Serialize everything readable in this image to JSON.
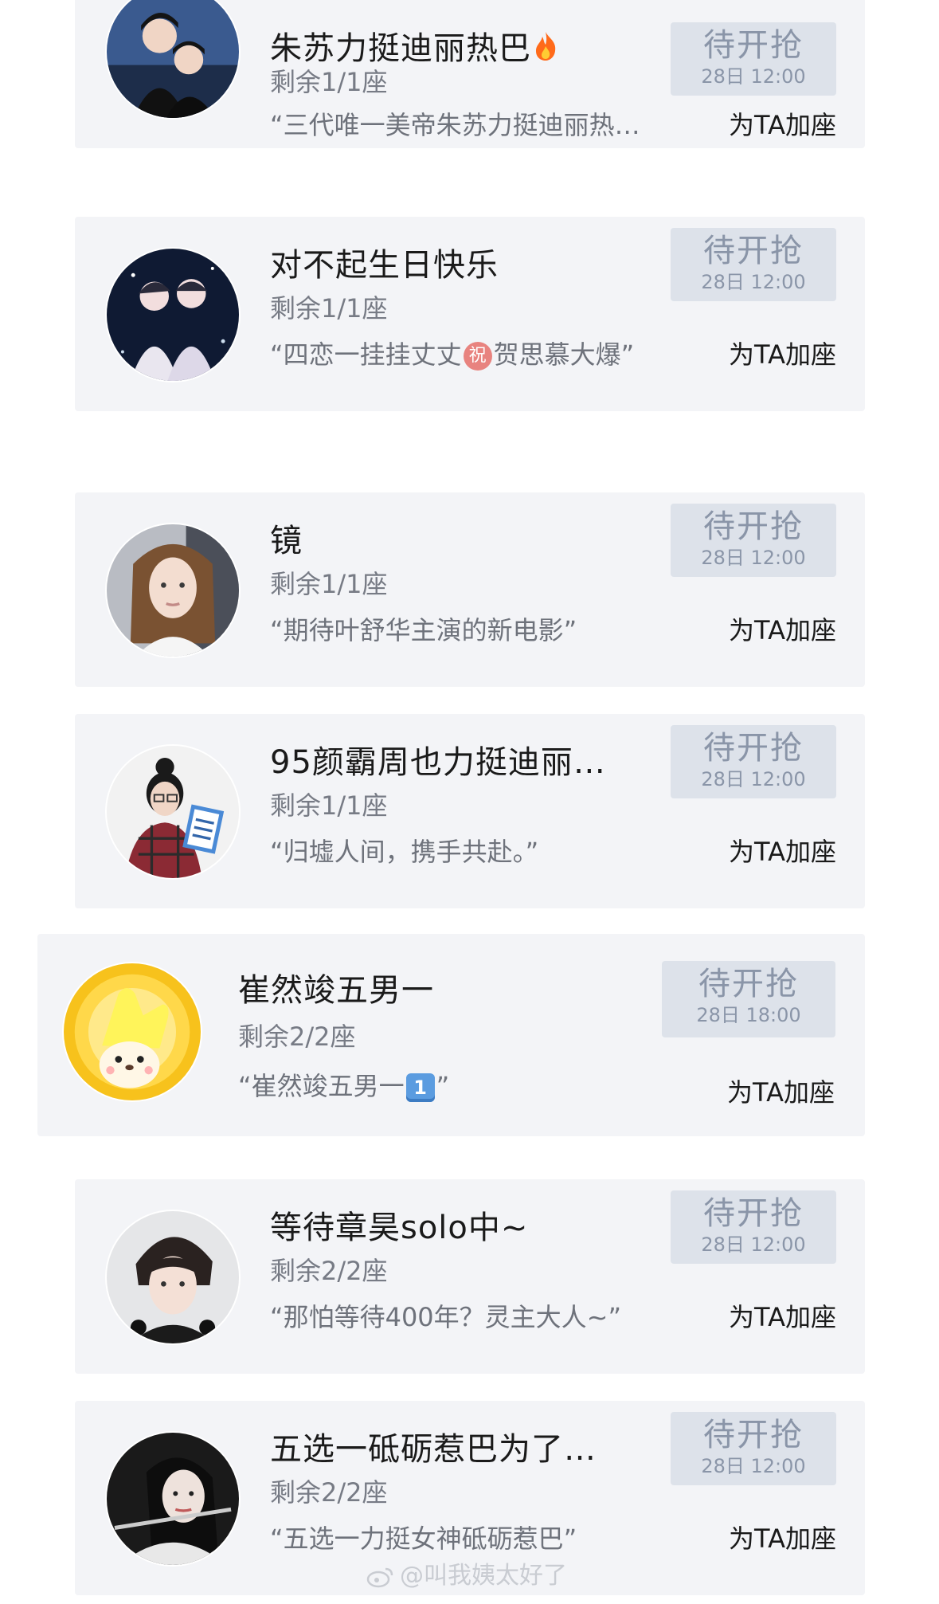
{
  "cards": [
    {
      "title": "朱苏力挺迪丽热巴",
      "seats": "剩余1/1座",
      "quote": "“三代唯一美帝朱苏力挺迪丽热…",
      "button_main": "待开抢",
      "button_time": "28日 12:00",
      "add_seat": "为TA加座",
      "title_icon": "fire-icon"
    },
    {
      "title": "对不起生日快乐",
      "seats": "剩余1/1座",
      "quote_before": "“四恋一挂挂丈丈",
      "quote_emoji": "祝",
      "quote_after": "贺思慕大爆”",
      "button_main": "待开抢",
      "button_time": "28日 12:00",
      "add_seat": "为TA加座"
    },
    {
      "title": "镜",
      "seats": "剩余1/1座",
      "quote": "“期待叶舒华主演的新电影”",
      "button_main": "待开抢",
      "button_time": "28日 12:00",
      "add_seat": "为TA加座"
    },
    {
      "title": "95颜霸周也力挺迪丽…",
      "seats": "剩余1/1座",
      "quote": "“归墟人间，携手共赴。”",
      "button_main": "待开抢",
      "button_time": "28日 12:00",
      "add_seat": "为TA加座"
    },
    {
      "title": "崔然竣五男一",
      "seats": "剩余2/2座",
      "quote_before": "“崔然竣五男一",
      "quote_emoji": "1",
      "quote_after": "”",
      "button_main": "待开抢",
      "button_time": "28日 18:00",
      "add_seat": "为TA加座"
    },
    {
      "title": "等待章昊solo中~",
      "seats": "剩余2/2座",
      "quote": "“那怕等待400年？灵主大人~”",
      "button_main": "待开抢",
      "button_time": "28日 12:00",
      "add_seat": "为TA加座"
    },
    {
      "title": "五选一砥砺惹巴为了…",
      "seats": "剩余2/2座",
      "quote": "“五选一力挺女神砥砺惹巴”",
      "button_main": "待开抢",
      "button_time": "28日 12:00",
      "add_seat": "为TA加座"
    }
  ],
  "watermark": "@叫我姨太好了",
  "colors": {
    "card_bg": "#f3f4f7",
    "button_bg": "#dde2ea",
    "button_text": "#8a95a8",
    "title_text": "#1a1a1a",
    "secondary_text": "#777b85"
  }
}
